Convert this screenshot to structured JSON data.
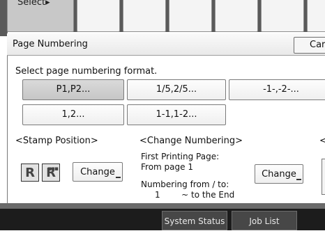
{
  "top_tabs": {
    "select_label": "Select▸"
  },
  "dialog": {
    "title": "Page Numbering",
    "cancel_label": "Car"
  },
  "format": {
    "prompt": "Select page numbering format.",
    "options": [
      "P1,P2...",
      "1/5,2/5...",
      "-1-,-2-...",
      "1,2...",
      "1-1,1-2..."
    ],
    "selected": "P1,P2..."
  },
  "stamp_position": {
    "heading": "<Stamp Position>",
    "change_label": "Change"
  },
  "change_numbering": {
    "heading": "<Change Numbering>",
    "first_page_label": "First Printing Page:",
    "first_page_value": "From page 1",
    "numbering_label": "Numbering from / to:",
    "numbering_value": "1        ~ to the End",
    "change_label": "Change"
  },
  "right_edge_heading": "<",
  "bottom_bar": {
    "system_status": "System Status",
    "job_list": "Job List"
  }
}
